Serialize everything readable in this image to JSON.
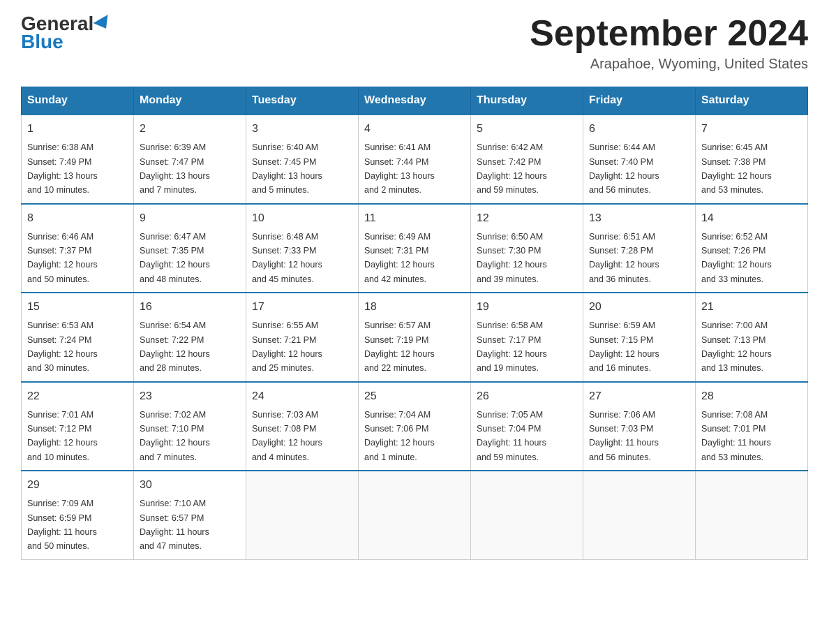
{
  "header": {
    "logo_line1": "General",
    "logo_line2": "Blue",
    "title": "September 2024",
    "subtitle": "Arapahoe, Wyoming, United States"
  },
  "days_of_week": [
    "Sunday",
    "Monday",
    "Tuesday",
    "Wednesday",
    "Thursday",
    "Friday",
    "Saturday"
  ],
  "weeks": [
    [
      {
        "day": "1",
        "sunrise": "6:38 AM",
        "sunset": "7:49 PM",
        "daylight": "13 hours and 10 minutes."
      },
      {
        "day": "2",
        "sunrise": "6:39 AM",
        "sunset": "7:47 PM",
        "daylight": "13 hours and 7 minutes."
      },
      {
        "day": "3",
        "sunrise": "6:40 AM",
        "sunset": "7:45 PM",
        "daylight": "13 hours and 5 minutes."
      },
      {
        "day": "4",
        "sunrise": "6:41 AM",
        "sunset": "7:44 PM",
        "daylight": "13 hours and 2 minutes."
      },
      {
        "day": "5",
        "sunrise": "6:42 AM",
        "sunset": "7:42 PM",
        "daylight": "12 hours and 59 minutes."
      },
      {
        "day": "6",
        "sunrise": "6:44 AM",
        "sunset": "7:40 PM",
        "daylight": "12 hours and 56 minutes."
      },
      {
        "day": "7",
        "sunrise": "6:45 AM",
        "sunset": "7:38 PM",
        "daylight": "12 hours and 53 minutes."
      }
    ],
    [
      {
        "day": "8",
        "sunrise": "6:46 AM",
        "sunset": "7:37 PM",
        "daylight": "12 hours and 50 minutes."
      },
      {
        "day": "9",
        "sunrise": "6:47 AM",
        "sunset": "7:35 PM",
        "daylight": "12 hours and 48 minutes."
      },
      {
        "day": "10",
        "sunrise": "6:48 AM",
        "sunset": "7:33 PM",
        "daylight": "12 hours and 45 minutes."
      },
      {
        "day": "11",
        "sunrise": "6:49 AM",
        "sunset": "7:31 PM",
        "daylight": "12 hours and 42 minutes."
      },
      {
        "day": "12",
        "sunrise": "6:50 AM",
        "sunset": "7:30 PM",
        "daylight": "12 hours and 39 minutes."
      },
      {
        "day": "13",
        "sunrise": "6:51 AM",
        "sunset": "7:28 PM",
        "daylight": "12 hours and 36 minutes."
      },
      {
        "day": "14",
        "sunrise": "6:52 AM",
        "sunset": "7:26 PM",
        "daylight": "12 hours and 33 minutes."
      }
    ],
    [
      {
        "day": "15",
        "sunrise": "6:53 AM",
        "sunset": "7:24 PM",
        "daylight": "12 hours and 30 minutes."
      },
      {
        "day": "16",
        "sunrise": "6:54 AM",
        "sunset": "7:22 PM",
        "daylight": "12 hours and 28 minutes."
      },
      {
        "day": "17",
        "sunrise": "6:55 AM",
        "sunset": "7:21 PM",
        "daylight": "12 hours and 25 minutes."
      },
      {
        "day": "18",
        "sunrise": "6:57 AM",
        "sunset": "7:19 PM",
        "daylight": "12 hours and 22 minutes."
      },
      {
        "day": "19",
        "sunrise": "6:58 AM",
        "sunset": "7:17 PM",
        "daylight": "12 hours and 19 minutes."
      },
      {
        "day": "20",
        "sunrise": "6:59 AM",
        "sunset": "7:15 PM",
        "daylight": "12 hours and 16 minutes."
      },
      {
        "day": "21",
        "sunrise": "7:00 AM",
        "sunset": "7:13 PM",
        "daylight": "12 hours and 13 minutes."
      }
    ],
    [
      {
        "day": "22",
        "sunrise": "7:01 AM",
        "sunset": "7:12 PM",
        "daylight": "12 hours and 10 minutes."
      },
      {
        "day": "23",
        "sunrise": "7:02 AM",
        "sunset": "7:10 PM",
        "daylight": "12 hours and 7 minutes."
      },
      {
        "day": "24",
        "sunrise": "7:03 AM",
        "sunset": "7:08 PM",
        "daylight": "12 hours and 4 minutes."
      },
      {
        "day": "25",
        "sunrise": "7:04 AM",
        "sunset": "7:06 PM",
        "daylight": "12 hours and 1 minute."
      },
      {
        "day": "26",
        "sunrise": "7:05 AM",
        "sunset": "7:04 PM",
        "daylight": "11 hours and 59 minutes."
      },
      {
        "day": "27",
        "sunrise": "7:06 AM",
        "sunset": "7:03 PM",
        "daylight": "11 hours and 56 minutes."
      },
      {
        "day": "28",
        "sunrise": "7:08 AM",
        "sunset": "7:01 PM",
        "daylight": "11 hours and 53 minutes."
      }
    ],
    [
      {
        "day": "29",
        "sunrise": "7:09 AM",
        "sunset": "6:59 PM",
        "daylight": "11 hours and 50 minutes."
      },
      {
        "day": "30",
        "sunrise": "7:10 AM",
        "sunset": "6:57 PM",
        "daylight": "11 hours and 47 minutes."
      },
      null,
      null,
      null,
      null,
      null
    ]
  ],
  "labels": {
    "sunrise": "Sunrise:",
    "sunset": "Sunset:",
    "daylight": "Daylight:"
  }
}
